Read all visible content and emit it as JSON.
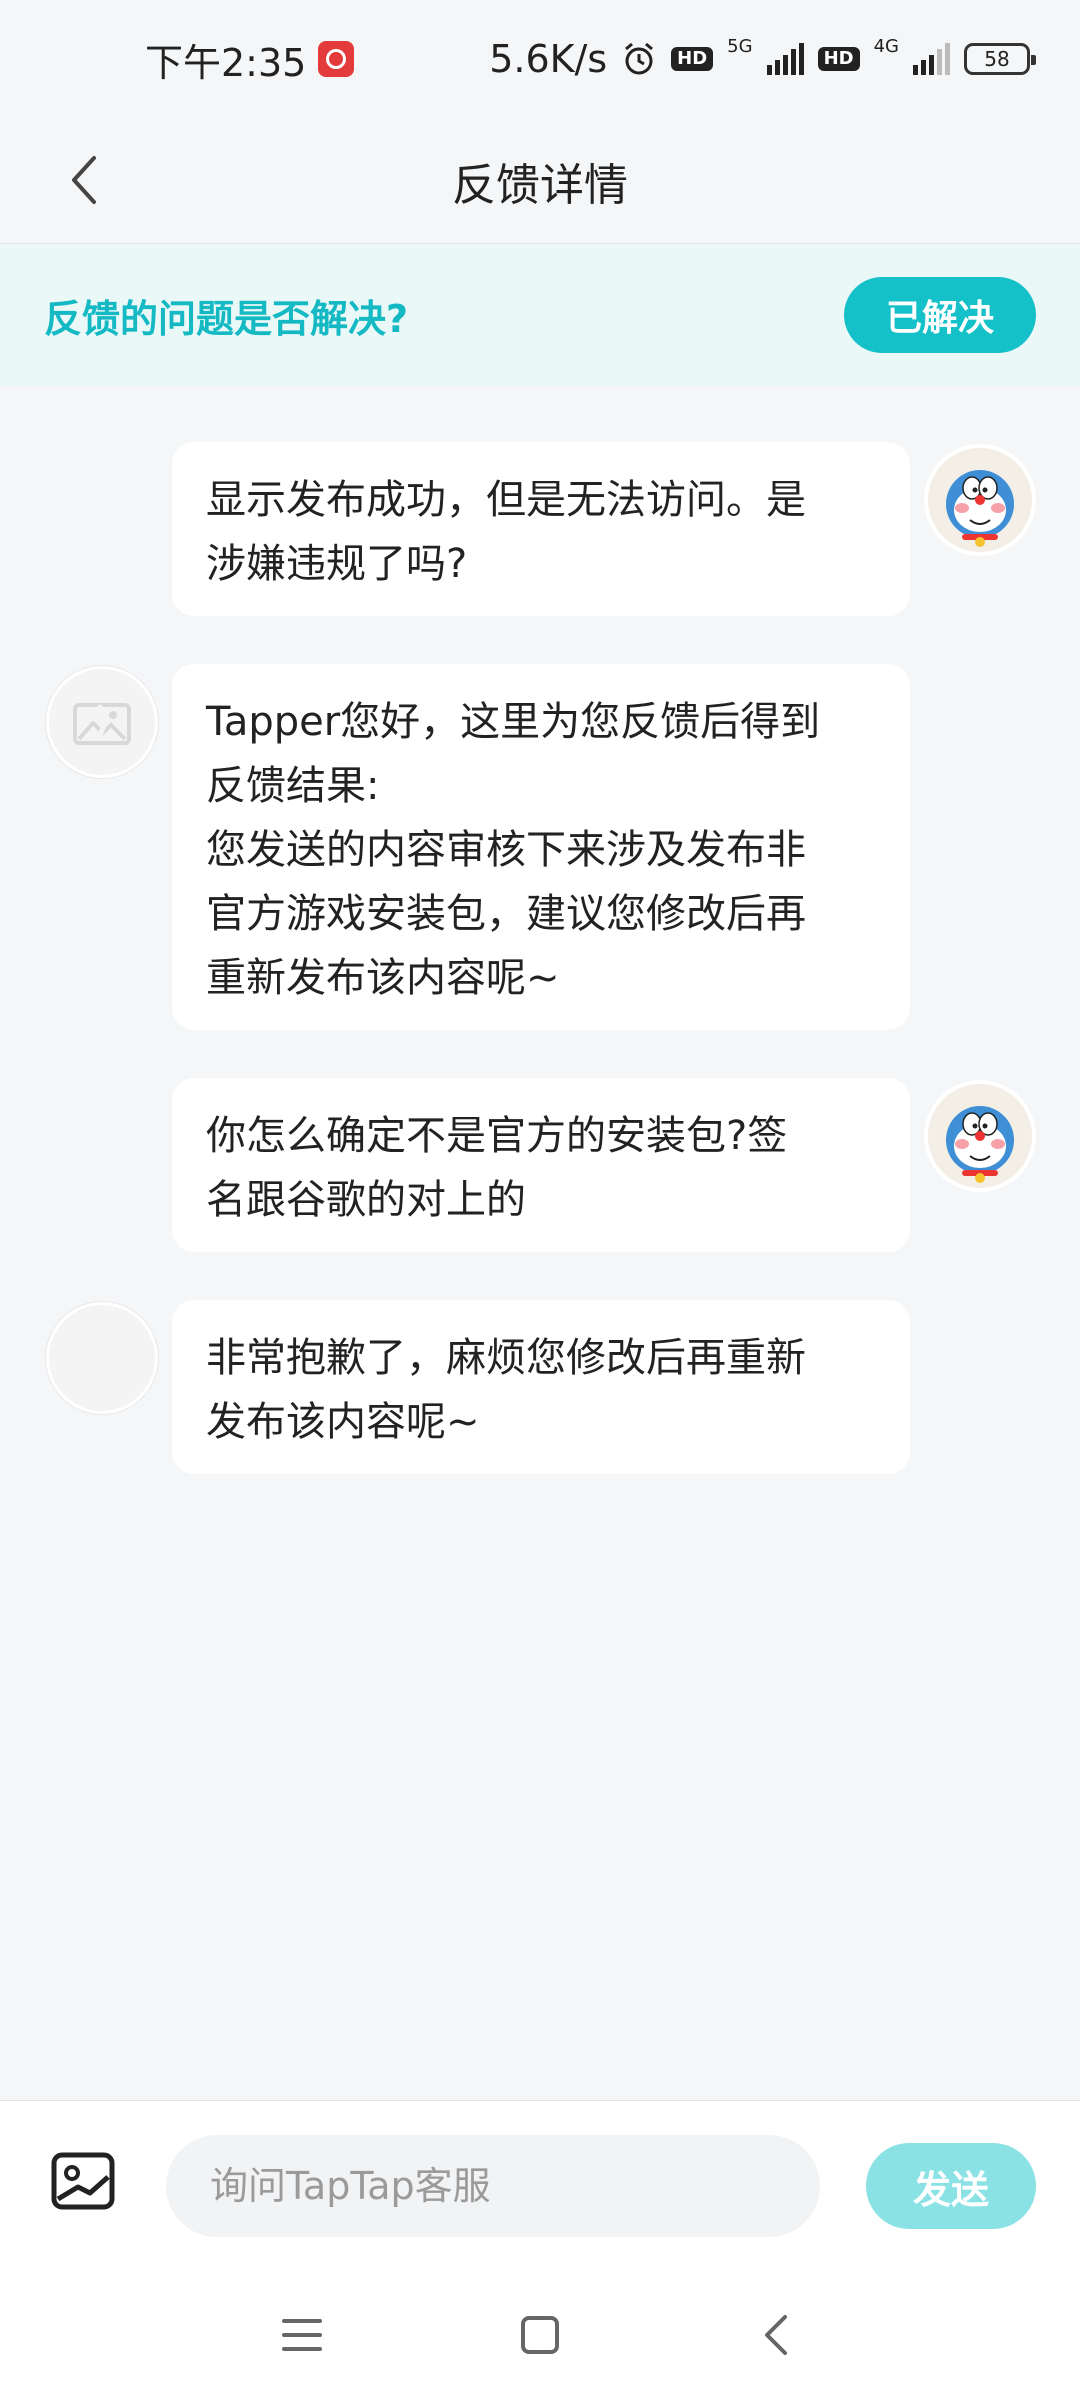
{
  "status_bar": {
    "time": "下午2:35",
    "net_speed": "5.6K/s",
    "hd_label": "HD",
    "network_1": "5G",
    "network_2": "4G",
    "battery": "58"
  },
  "header": {
    "title": "反馈详情"
  },
  "resolve_banner": {
    "question": "反馈的问题是否解决?",
    "button_label": "已解决",
    "accent_color": "#15c1c8"
  },
  "messages": [
    {
      "sender": "user",
      "text": "显示发布成功，但是无法访问。是\n涉嫌违规了吗?"
    },
    {
      "sender": "service",
      "text": "Tapper您好，这里为您反馈后得到\n反馈结果:\n您发送的内容审核下来涉及发布非\n官方游戏安装包，建议您修改后再\n重新发布该内容呢~"
    },
    {
      "sender": "user",
      "text": "你怎么确定不是官方的安装包?签\n名跟谷歌的对上的"
    },
    {
      "sender": "service",
      "text": "非常抱歉了，麻烦您修改后再重新\n发布该内容呢~"
    }
  ],
  "input_bar": {
    "placeholder": "询问TapTap客服",
    "send_label": "发送"
  },
  "icons": {
    "back": "chevron-left-icon",
    "image": "image-icon",
    "nav_menu": "menu-icon",
    "nav_home": "square-icon",
    "nav_back": "back-icon"
  }
}
